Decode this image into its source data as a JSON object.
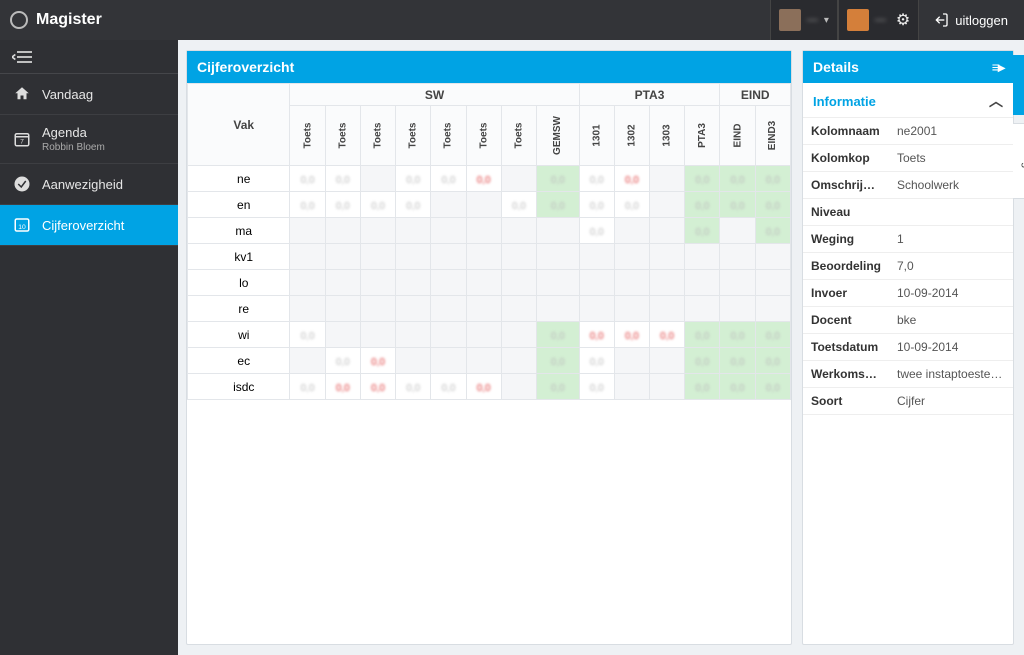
{
  "app": {
    "name": "Magister"
  },
  "topbar": {
    "user1": "—",
    "user2": "—",
    "logout": "uitloggen"
  },
  "sidebar": {
    "items": [
      {
        "label": "Vandaag"
      },
      {
        "label": "Agenda",
        "sub": "Robbin Bloem"
      },
      {
        "label": "Aanwezigheid"
      },
      {
        "label": "Cijferoverzicht"
      }
    ]
  },
  "grades": {
    "title": "Cijferoverzicht",
    "vak_header": "Vak",
    "groups": [
      {
        "label": "SW",
        "span": 8
      },
      {
        "label": "PTA3",
        "span": 4
      },
      {
        "label": "EIND",
        "span": 2
      }
    ],
    "columns": [
      "Toets",
      "Toets",
      "Toets",
      "Toets",
      "Toets",
      "Toets",
      "Toets",
      "GEMSW",
      "1301",
      "1302",
      "1303",
      "PTA3",
      "EIND",
      "EIND3"
    ],
    "rows": [
      {
        "vak": "ne",
        "cells": [
          "v",
          "v",
          "",
          "v",
          "v",
          "r",
          "",
          "g",
          "v",
          "r",
          "",
          "g",
          "g",
          "g"
        ]
      },
      {
        "vak": "en",
        "cells": [
          "v",
          "v",
          "v",
          "v",
          "",
          "",
          "v",
          "g",
          "v",
          "v",
          "",
          "g",
          "g",
          "g"
        ]
      },
      {
        "vak": "ma",
        "cells": [
          "",
          "",
          "",
          "",
          "",
          "",
          "",
          "",
          "v",
          "",
          "",
          "g",
          "",
          "g"
        ]
      },
      {
        "vak": "kv1",
        "cells": [
          "",
          "",
          "",
          "",
          "",
          "",
          "",
          "",
          "",
          "",
          "",
          "",
          "",
          ""
        ]
      },
      {
        "vak": "lo",
        "cells": [
          "",
          "",
          "",
          "",
          "",
          "",
          "",
          "",
          "",
          "",
          "",
          "",
          "",
          ""
        ]
      },
      {
        "vak": "re",
        "cells": [
          "",
          "",
          "",
          "",
          "",
          "",
          "",
          "",
          "",
          "",
          "",
          "",
          "",
          ""
        ]
      },
      {
        "vak": "wi",
        "cells": [
          "v",
          "",
          "",
          "",
          "",
          "",
          "",
          "g",
          "r",
          "r",
          "r",
          "g",
          "g",
          "g"
        ]
      },
      {
        "vak": "ec",
        "cells": [
          "",
          "v",
          "r",
          "",
          "",
          "",
          "",
          "g",
          "v",
          "",
          "",
          "g",
          "g",
          "g"
        ]
      },
      {
        "vak": "isdc",
        "cells": [
          "v",
          "r",
          "r",
          "v",
          "v",
          "r",
          "",
          "g",
          "v",
          "",
          "",
          "g",
          "g",
          "g"
        ]
      }
    ]
  },
  "details": {
    "title": "Details",
    "section": "Informatie",
    "rows": [
      {
        "k": "Kolomnaam",
        "v": "ne2001"
      },
      {
        "k": "Kolomkop",
        "v": "Toets"
      },
      {
        "k": "Omschrijving",
        "v": "Schoolwerk"
      },
      {
        "k": "Niveau",
        "v": ""
      },
      {
        "k": "Weging",
        "v": "1"
      },
      {
        "k": "Beoordeling",
        "v": "7,0"
      },
      {
        "k": "Invoer",
        "v": "10-09-2014"
      },
      {
        "k": "Docent",
        "v": "bke"
      },
      {
        "k": "Toetsdatum",
        "v": "10-09-2014"
      },
      {
        "k": "Werkomschri...",
        "v": "twee instaptoesten ne"
      },
      {
        "k": "Soort",
        "v": "Cijfer"
      }
    ]
  },
  "vtabs": {
    "details": "Details",
    "weergave": "Weergave"
  }
}
